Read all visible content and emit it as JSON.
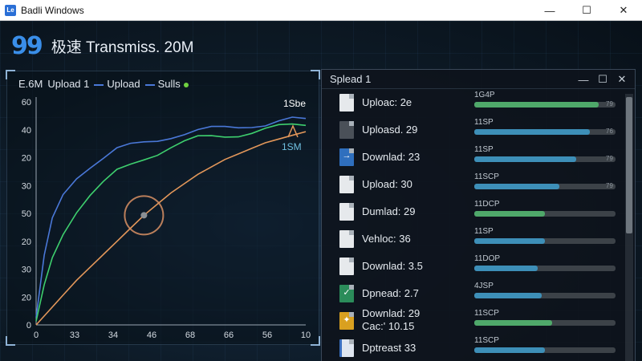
{
  "window": {
    "title": "Badli Windows",
    "icon_text": "Le",
    "minimize": "—",
    "maximize": "☐",
    "close": "✕"
  },
  "header": {
    "logo": "99",
    "title": "极速 Transmiss. 20M"
  },
  "chart_data": {
    "type": "line",
    "legend": [
      {
        "label": "E.6M",
        "color": ""
      },
      {
        "label": "Upload 1",
        "color": ""
      },
      {
        "label": "Upload",
        "color": "#4a78d8"
      },
      {
        "label": "Sulls",
        "color": "#4a78d8"
      }
    ],
    "legend_dot_color": "#6fd040",
    "ytick_labels": [
      "60",
      "40",
      "20",
      "30",
      "50",
      "20",
      "30",
      "20",
      "0"
    ],
    "xtick_labels": [
      "0",
      "33",
      "34",
      "46",
      "68",
      "66",
      "56",
      "10"
    ],
    "annotations": [
      {
        "text": "1Sbe",
        "color": "#ffffff"
      },
      {
        "text": "1SM",
        "color": "#6fc0e0"
      }
    ],
    "xlim": [
      0,
      10
    ],
    "ylim": [
      0,
      60
    ],
    "series": [
      {
        "color": "#4a78d8",
        "x": [
          0,
          0.3,
          0.6,
          1.0,
          1.5,
          2.0,
          2.5,
          3.0,
          3.5,
          4.0,
          4.5,
          5.0,
          5.5,
          6.0,
          6.5,
          7.0,
          7.5,
          8.0,
          8.5,
          9.0,
          9.5,
          10
        ],
        "y": [
          2,
          18,
          28,
          35,
          40,
          43,
          45,
          47,
          48,
          49,
          50,
          51,
          51.5,
          52,
          52.5,
          53,
          53.5,
          54,
          54,
          54.5,
          55,
          55
        ]
      },
      {
        "color": "#3ecf6e",
        "x": [
          0,
          0.3,
          0.6,
          1.0,
          1.5,
          2.0,
          2.5,
          3.0,
          3.5,
          4.0,
          4.5,
          5.0,
          5.5,
          6.0,
          6.5,
          7.0,
          7.5,
          8.0,
          8.5,
          9.0,
          9.5,
          10
        ],
        "y": [
          1,
          10,
          18,
          25,
          31,
          35,
          38,
          41,
          43,
          45,
          46.5,
          48,
          49,
          50,
          50.5,
          51,
          51.5,
          52,
          52.5,
          53,
          53.5,
          54
        ]
      },
      {
        "color": "#e3975a",
        "x": [
          0,
          0.5,
          1.0,
          1.5,
          2.0,
          2.5,
          3.0,
          3.5,
          4.0,
          4.5,
          5.0,
          5.5,
          6.0,
          6.5,
          7.0,
          7.5,
          8.0,
          8.5,
          9.0,
          9.5,
          10
        ],
        "y": [
          0,
          4,
          8,
          12,
          15.5,
          19,
          22.5,
          26,
          29.5,
          32.5,
          35.5,
          38,
          40.5,
          42.5,
          44.5,
          46,
          47.5,
          49,
          50,
          51,
          52
        ]
      }
    ],
    "grid": false
  },
  "side_panel": {
    "title": "Splead 1",
    "minimize": "—",
    "maximize": "☐",
    "close": "✕",
    "rows": [
      {
        "name": "Uploac: 2e",
        "rate": "1G4P",
        "fill": 0.88,
        "color": "#4fa86a",
        "icon": "doc",
        "glyph": "",
        "pct": "79"
      },
      {
        "name": "Uploasd. 29",
        "rate": "11SP",
        "fill": 0.82,
        "color": "#3d8fb8",
        "icon": "dark",
        "glyph": "",
        "pct": "76"
      },
      {
        "name": "Downlad: 23",
        "rate": "11SP",
        "fill": 0.72,
        "color": "#3d8fb8",
        "icon": "blue",
        "glyph": "→",
        "pct": "79"
      },
      {
        "name": "Upload: 30",
        "rate": "11SCP",
        "fill": 0.6,
        "color": "#3d8fb8",
        "icon": "doc",
        "glyph": "",
        "pct": "79"
      },
      {
        "name": "Dumlad: 29",
        "rate": "11DCP",
        "fill": 0.5,
        "color": "#4fa86a",
        "icon": "doc",
        "glyph": "",
        "pct": ""
      },
      {
        "name": "Vehloc: 36",
        "rate": "11SP",
        "fill": 0.5,
        "color": "#3d8fb8",
        "icon": "doc",
        "glyph": "",
        "pct": ""
      },
      {
        "name": "Downlad: 3.5",
        "rate": "11DOP",
        "fill": 0.45,
        "color": "#3d8fb8",
        "icon": "doc",
        "glyph": "",
        "pct": ""
      },
      {
        "name": "Dpnead: 2.7",
        "rate": "4JSP",
        "fill": 0.48,
        "color": "#3d8fb8",
        "icon": "green",
        "glyph": "✓",
        "pct": ""
      },
      {
        "name": "Downlad: 29",
        "name2": "Cac:' 10.15",
        "rate": "11SCP",
        "fill": 0.55,
        "color": "#4fa86a",
        "icon": "gold",
        "glyph": "✦",
        "pct": ""
      },
      {
        "name": "Dptreast 33",
        "rate": "11SCP",
        "fill": 0.5,
        "color": "#3d8fb8",
        "icon": "note",
        "glyph": "",
        "pct": ""
      }
    ]
  }
}
